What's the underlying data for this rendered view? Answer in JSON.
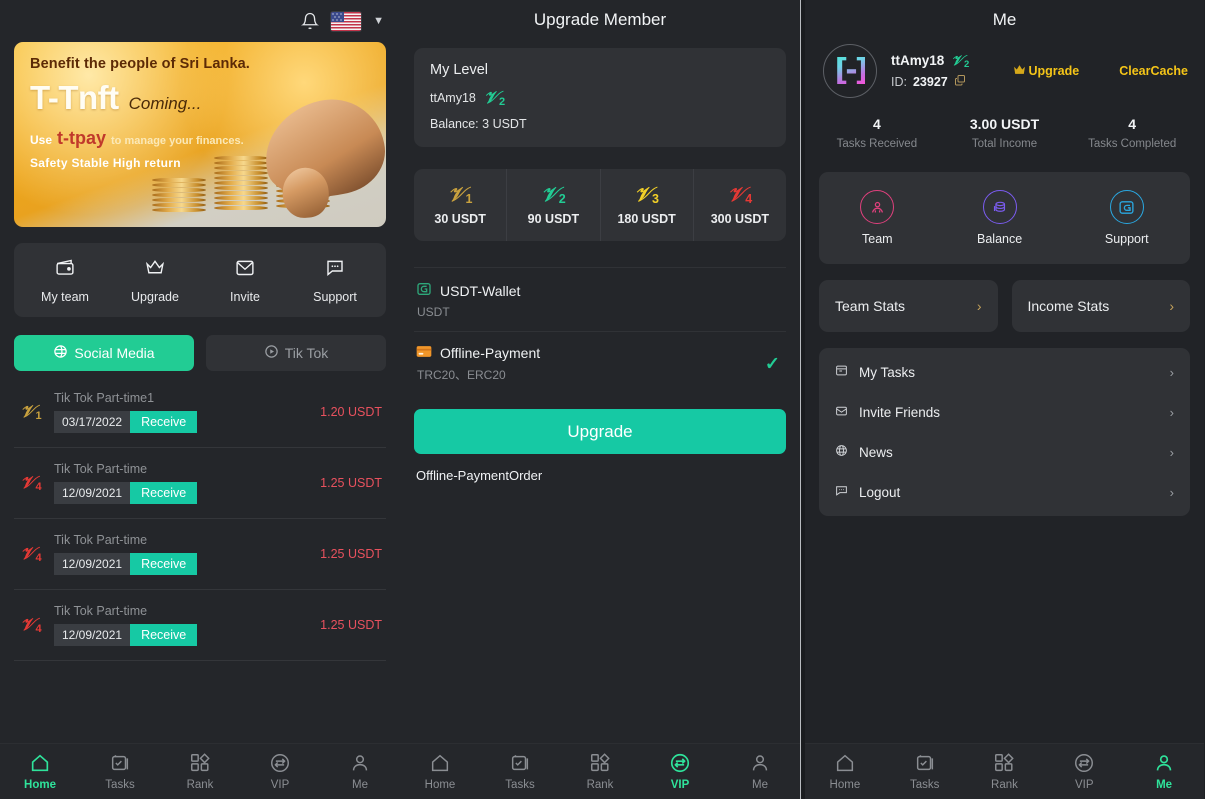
{
  "home": {
    "header": {
      "bell_icon": "bell-icon",
      "flag_icon": "us-flag-icon",
      "chevron_icon": "chevron-down-icon"
    },
    "banner": {
      "line1": "Benefit the people of Sri Lanka.",
      "brand": "T-Tnft",
      "coming": "Coming...",
      "use": "Use",
      "pay": "t-tpay",
      "tagline": "to manage your finances.",
      "line4": "Safety  Stable  High return"
    },
    "quick_actions": [
      {
        "label": "My team",
        "icon": "wallet-icon"
      },
      {
        "label": "Upgrade",
        "icon": "crown-icon"
      },
      {
        "label": "Invite",
        "icon": "envelope-icon"
      },
      {
        "label": "Support",
        "icon": "chat-icon"
      }
    ],
    "tabs": [
      {
        "label": "Social Media",
        "icon": "globe-icon",
        "active": true
      },
      {
        "label": "Tik Tok",
        "icon": "play-circle-icon",
        "active": false
      }
    ],
    "tasks": [
      {
        "level": "1",
        "level_color": "#c8a13e",
        "title": "Tik Tok Part-time1",
        "date": "03/17/2022",
        "action": "Receive",
        "amount": "1.20 USDT"
      },
      {
        "level": "4",
        "level_color": "#e53935",
        "title": "Tik Tok Part-time",
        "date": "12/09/2021",
        "action": "Receive",
        "amount": "1.25 USDT"
      },
      {
        "level": "4",
        "level_color": "#e53935",
        "title": "Tik Tok Part-time",
        "date": "12/09/2021",
        "action": "Receive",
        "amount": "1.25 USDT"
      },
      {
        "level": "4",
        "level_color": "#e53935",
        "title": "Tik Tok Part-time",
        "date": "12/09/2021",
        "action": "Receive",
        "amount": "1.25 USDT"
      }
    ],
    "bottom_nav": [
      {
        "label": "Home",
        "icon": "home-icon",
        "active": true
      },
      {
        "label": "Tasks",
        "icon": "tasks-icon",
        "active": false
      },
      {
        "label": "Rank",
        "icon": "rank-icon",
        "active": false
      },
      {
        "label": "VIP",
        "icon": "vip-icon",
        "active": false
      },
      {
        "label": "Me",
        "icon": "person-icon",
        "active": false
      }
    ]
  },
  "vip": {
    "title": "Upgrade Member",
    "my_level": {
      "heading": "My Level",
      "username": "ttAmy18",
      "level": "2",
      "level_color": "#22cc94",
      "balance_label": "Balance:",
      "balance_value": "3 USDT"
    },
    "levels": [
      {
        "level": "1",
        "color": "#c8a13e",
        "price": "30 USDT"
      },
      {
        "level": "2",
        "color": "#22cc94",
        "price": "90 USDT"
      },
      {
        "level": "3",
        "color": "#f2d027",
        "price": "180 USDT"
      },
      {
        "level": "4",
        "color": "#e53935",
        "price": "300 USDT"
      }
    ],
    "payments": [
      {
        "name": "USDT-Wallet",
        "sub": "USDT",
        "icon": "wallet-green-icon",
        "selected": false
      },
      {
        "name": "Offline-Payment",
        "sub": "TRC20、ERC20",
        "icon": "credit-card-icon",
        "selected": true
      }
    ],
    "upgrade_button": "Upgrade",
    "order_link": "Offline-PaymentOrder",
    "bottom_nav": [
      {
        "label": "Home",
        "icon": "home-icon",
        "active": false
      },
      {
        "label": "Tasks",
        "icon": "tasks-icon",
        "active": false
      },
      {
        "label": "Rank",
        "icon": "rank-icon",
        "active": false
      },
      {
        "label": "VIP",
        "icon": "vip-icon",
        "active": true
      },
      {
        "label": "Me",
        "icon": "person-icon",
        "active": false
      }
    ]
  },
  "me": {
    "title": "Me",
    "profile": {
      "avatar_icon": "gradient-avatar-icon",
      "username": "ttAmy18",
      "level": "2",
      "level_color": "#22cc94",
      "id_label": "ID:",
      "id_value": "23927",
      "copy_icon": "copy-icon"
    },
    "actions": [
      {
        "label": "Upgrade",
        "icon": "crown-icon",
        "color": "#f5c518"
      },
      {
        "label": "ClearCache",
        "icon": "",
        "color": "#f5c518"
      }
    ],
    "stats": [
      {
        "value": "4",
        "label": "Tasks Received"
      },
      {
        "value": "3.00 USDT",
        "label": "Total Income"
      },
      {
        "value": "4",
        "label": "Tasks Completed"
      }
    ],
    "quick_actions": [
      {
        "label": "Team",
        "icon": "team-icon",
        "color": "#e0407d"
      },
      {
        "label": "Balance",
        "icon": "coins-icon",
        "color": "#7b5cf0"
      },
      {
        "label": "Support",
        "icon": "wallet-support-icon",
        "color": "#2aa7e0"
      }
    ],
    "stat_cards": [
      {
        "label": "Team Stats",
        "chevron": "›"
      },
      {
        "label": "Income Stats",
        "chevron": "›"
      }
    ],
    "menu": [
      {
        "label": "My Tasks",
        "icon": "my-tasks-icon",
        "chevron": "›"
      },
      {
        "label": "Invite Friends",
        "icon": "invite-friends-icon",
        "chevron": "›"
      },
      {
        "label": "News",
        "icon": "news-icon",
        "chevron": "›"
      },
      {
        "label": "Logout",
        "icon": "logout-icon",
        "chevron": "›"
      }
    ],
    "bottom_nav": [
      {
        "label": "Home",
        "icon": "home-icon",
        "active": false
      },
      {
        "label": "Tasks",
        "icon": "tasks-icon",
        "active": false
      },
      {
        "label": "Rank",
        "icon": "rank-icon",
        "active": false
      },
      {
        "label": "VIP",
        "icon": "vip-icon",
        "active": false
      },
      {
        "label": "Me",
        "icon": "person-icon",
        "active": true
      }
    ]
  }
}
